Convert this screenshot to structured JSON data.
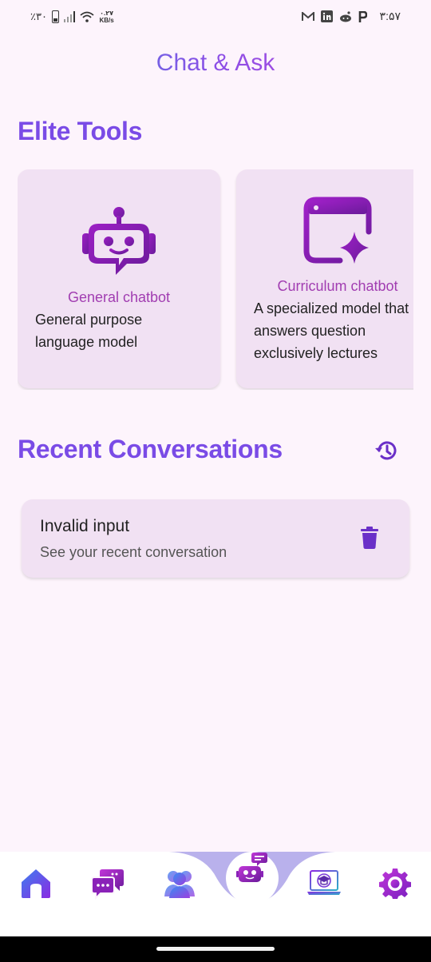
{
  "status_bar": {
    "battery_text": "٪۳۰",
    "net_speed_value": "۰.۲۷",
    "net_speed_unit": "KB/s",
    "time": "۳:۵۷",
    "notification_icons": [
      "gmail-icon",
      "linkedin-icon",
      "reddit-icon",
      "p-app-icon"
    ]
  },
  "header": {
    "title": "Chat & Ask"
  },
  "elite_tools": {
    "heading": "Elite Tools",
    "items": [
      {
        "name": "General chatbot",
        "description": "General purpose language model",
        "icon": "robot-chat-icon"
      },
      {
        "name": "Curriculum chatbot",
        "description": "A specialized model that answers question exclusively lectures",
        "icon": "window-sparkle-icon"
      }
    ]
  },
  "recent": {
    "heading": "Recent Conversations",
    "history_icon": "history-icon",
    "items": [
      {
        "title": "Invalid input",
        "subtitle": "See your recent conversation",
        "action_icon": "trash-icon"
      }
    ]
  },
  "bottom_nav": {
    "items": [
      {
        "icon": "home-icon"
      },
      {
        "icon": "chat-bubbles-icon"
      },
      {
        "icon": "people-icon"
      },
      {
        "icon": "robot-chat-icon",
        "active": true
      },
      {
        "icon": "laptop-graduation-icon"
      },
      {
        "icon": "gear-icon"
      }
    ]
  },
  "colors": {
    "background": "#fdf4fc",
    "accent": "#7a4be6",
    "card": "#f1e1f3",
    "tool_name": "#a13db1",
    "nav_curve": "#b9b1ec"
  }
}
